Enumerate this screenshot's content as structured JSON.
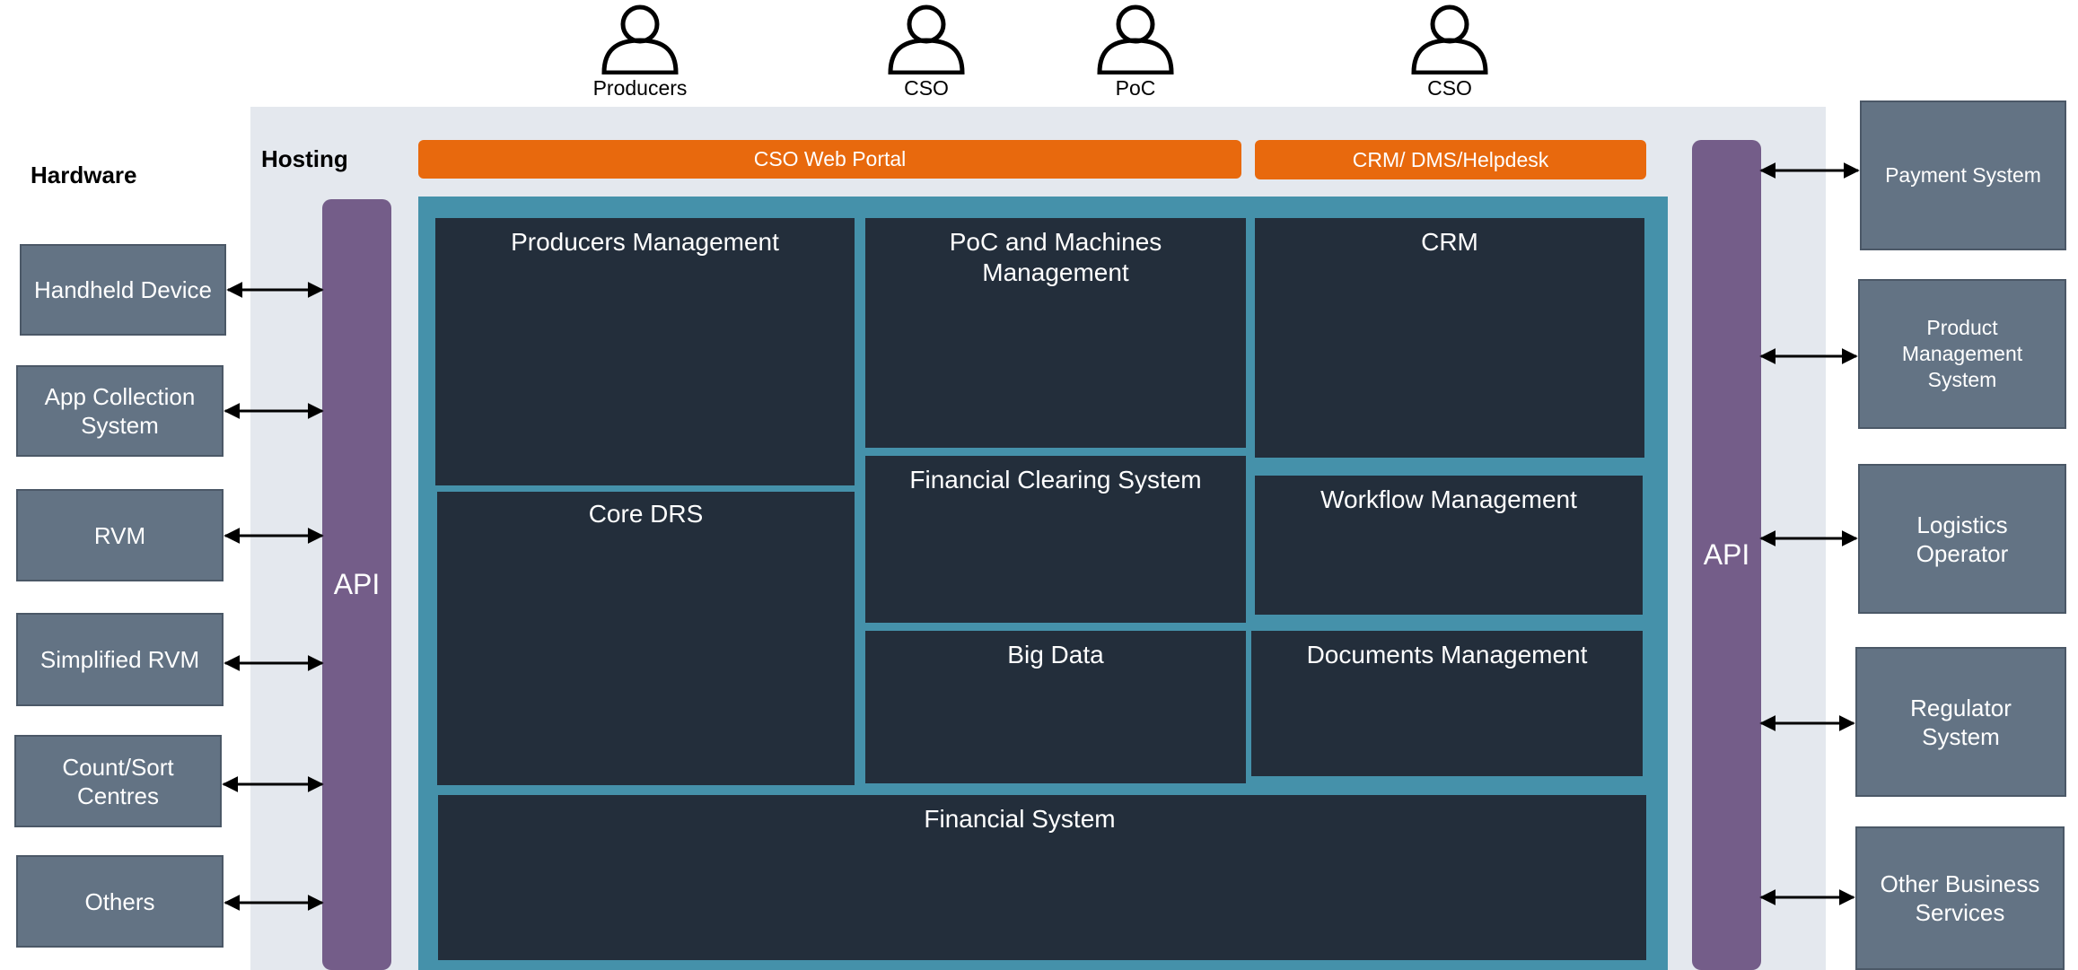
{
  "actors": [
    {
      "label": "Producers",
      "icon": "person-icon"
    },
    {
      "label": "CSO",
      "icon": "person-icon"
    },
    {
      "label": "PoC",
      "icon": "person-icon"
    },
    {
      "label": "CSO",
      "icon": "person-icon"
    }
  ],
  "hardware": {
    "title": "Hardware",
    "items": [
      "Handheld Device",
      "App Collection System",
      "RVM",
      "Simplified RVM",
      "Count/Sort Centres",
      "Others"
    ]
  },
  "hosting": {
    "title": "Hosting",
    "api_left": "API",
    "api_right": "API",
    "portal_bar": "CSO Web Portal",
    "crm_bar": "CRM/ DMS/Helpdesk",
    "modules": {
      "producers_management": "Producers Management",
      "core_drs": "Core DRS",
      "poc_machines": "PoC and Machines Management",
      "financial_clearing": "Financial Clearing System",
      "big_data": "Big Data",
      "crm": "CRM",
      "workflow": "Workflow Management",
      "documents": "Documents Management",
      "financial_system": "Financial System"
    }
  },
  "external_systems": [
    "Payment System",
    "Product Management System",
    "Logistics Operator",
    "Regulator System",
    "Other Business Services"
  ],
  "colors": {
    "hosting_bg": "#e4e8ee",
    "api": "#745d89",
    "orange": "#e8690d",
    "teal": "#4591aa",
    "module": "#232e3b",
    "box": "#637384"
  }
}
